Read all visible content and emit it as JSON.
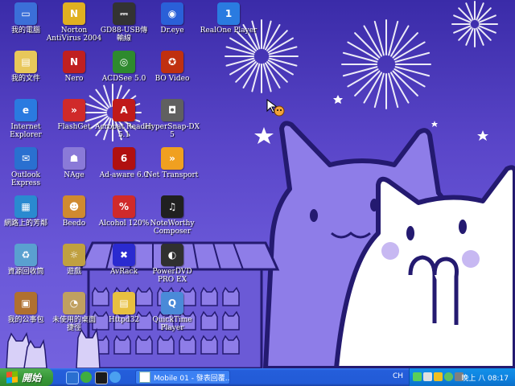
{
  "desktop": {
    "icons": [
      {
        "label": "我的電腦",
        "icon": "my-computer-icon",
        "color": "#3b6fd8",
        "glyph": "▭"
      },
      {
        "label": "Norton\nAntiVirus 2004",
        "icon": "norton-antivirus-icon",
        "color": "#e0b020",
        "glyph": "N"
      },
      {
        "label": "GD88-USB傳\n輸線",
        "icon": "usb-cable-icon",
        "color": "#333333",
        "glyph": "⎓"
      },
      {
        "label": "Dr.eye",
        "icon": "dreye-icon",
        "color": "#2a60d8",
        "glyph": "◉"
      },
      {
        "label": "RealOne Player",
        "icon": "realone-player-icon",
        "color": "#2a7be0",
        "glyph": "1"
      },
      {
        "label": "我的文件",
        "icon": "my-documents-icon",
        "color": "#e8c75a",
        "glyph": "▤"
      },
      {
        "label": "Nero",
        "icon": "nero-icon",
        "color": "#c02020",
        "glyph": "N"
      },
      {
        "label": "ACDSee 5.0",
        "icon": "acdsee-icon",
        "color": "#2e8a2e",
        "glyph": "◎"
      },
      {
        "label": "BO Video",
        "icon": "bo-video-icon",
        "color": "#c03010",
        "glyph": "✪"
      },
      {
        "label": "Internet\nExplorer",
        "icon": "internet-explorer-icon",
        "color": "#2a7ae0",
        "glyph": "e"
      },
      {
        "label": "FlashGet",
        "icon": "flashget-icon",
        "color": "#d02a2a",
        "glyph": "»"
      },
      {
        "label": "Acrobat Reader\n5.1",
        "icon": "acrobat-reader-icon",
        "color": "#c01a1a",
        "glyph": "A"
      },
      {
        "label": "HyperSnap-DX\n5",
        "icon": "hypersnap-icon",
        "color": "#606060",
        "glyph": "◘"
      },
      {
        "label": "Outlook\nExpress",
        "icon": "outlook-express-icon",
        "color": "#2a70d0",
        "glyph": "✉"
      },
      {
        "label": "NAge",
        "icon": "nage-icon",
        "color": "#8a7ad8",
        "glyph": "☗"
      },
      {
        "label": "Ad-aware 6.0",
        "icon": "adaware-icon",
        "color": "#b01010",
        "glyph": "6"
      },
      {
        "label": "Net Transport",
        "icon": "net-transport-icon",
        "color": "#f0a020",
        "glyph": "»"
      },
      {
        "label": "網路上的芳鄰",
        "icon": "network-places-icon",
        "color": "#2a8ad0",
        "glyph": "▦"
      },
      {
        "label": "Beedo",
        "icon": "beedo-icon",
        "color": "#d08a30",
        "glyph": "☻"
      },
      {
        "label": "Alcohol 120%",
        "icon": "alcohol-120-icon",
        "color": "#d02a2a",
        "glyph": "%"
      },
      {
        "label": "NoteWorthy\nComposer",
        "icon": "noteworthy-composer-icon",
        "color": "#202020",
        "glyph": "♫"
      },
      {
        "label": "資源回收筒",
        "icon": "recycle-bin-icon",
        "color": "#5aa0d0",
        "glyph": "♻"
      },
      {
        "label": "遊戲",
        "icon": "games-folder-icon",
        "color": "#c0a040",
        "glyph": "☼"
      },
      {
        "label": "AvRack",
        "icon": "avrack-icon",
        "color": "#2a2ad0",
        "glyph": "✖"
      },
      {
        "label": "PowerDVD\nPRO EX",
        "icon": "powerdvd-icon",
        "color": "#303030",
        "glyph": "◐"
      },
      {
        "label": "我的公事包",
        "icon": "briefcase-icon",
        "color": "#b07030",
        "glyph": "▣"
      },
      {
        "label": "未使用的桌面\n捷徑",
        "icon": "unused-shortcuts-icon",
        "color": "#c0a060",
        "glyph": "◔"
      },
      {
        "label": "Httpd32",
        "icon": "httpd32-icon",
        "color": "#e8c040",
        "glyph": "▤"
      },
      {
        "label": "QuickTime\nPlayer",
        "icon": "quicktime-icon",
        "color": "#4a8ad8",
        "glyph": "Q"
      }
    ]
  },
  "taskbar": {
    "start_label": "開始",
    "quick_launch": [
      "show-desktop-icon",
      "msn-icon",
      "winamp-icon",
      "internet-explorer-icon"
    ],
    "task_button_label": "Mobile 01 - 發表回覆...",
    "language_indicator": "CH",
    "tray_icons": [
      "network-tray-icon",
      "volume-tray-icon",
      "antivirus-tray-icon",
      "messenger-tray-icon",
      "display-tray-icon"
    ],
    "clock": "晚上 八 08:17"
  },
  "colors": {
    "desktop_bg": "#5a46c9",
    "taskbar": "#245edb",
    "start_button": "#3a9a3a",
    "tray": "#0f84e1"
  }
}
